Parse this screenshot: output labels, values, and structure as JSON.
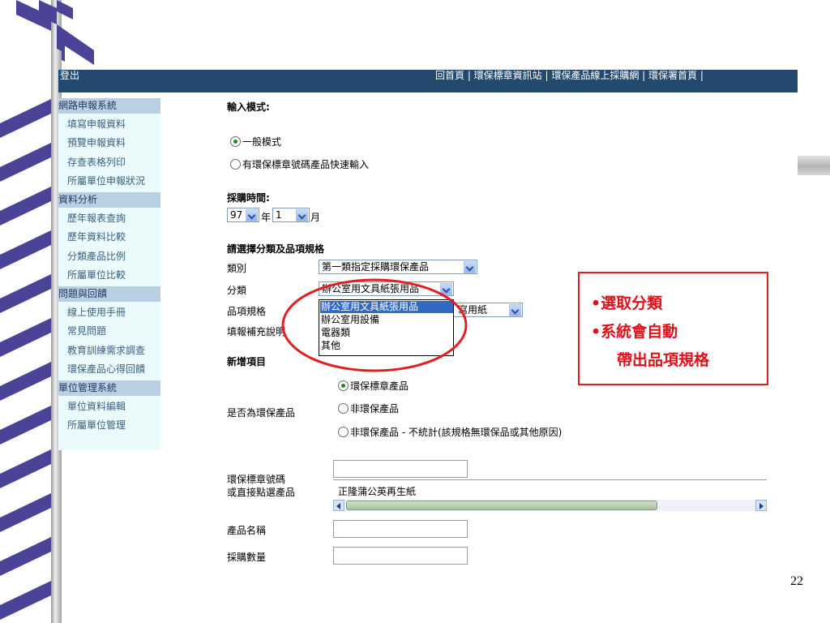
{
  "top_bar": {
    "left_label": "登出",
    "links": "回首頁 | 環保標章資訊站 | 環保產品線上採購網 | 環保署首頁 |"
  },
  "sidebar": {
    "items": [
      {
        "label": "網路申報系統",
        "type": "head"
      },
      {
        "label": "填寫申報資料",
        "type": "sub"
      },
      {
        "label": "預覽申報資料",
        "type": "sub"
      },
      {
        "label": "存查表格列印",
        "type": "sub"
      },
      {
        "label": "所屬單位申報狀況",
        "type": "sub"
      },
      {
        "label": "資料分析",
        "type": "head"
      },
      {
        "label": "歷年報表查詢",
        "type": "sub"
      },
      {
        "label": "歷年資料比較",
        "type": "sub"
      },
      {
        "label": "分類產品比例",
        "type": "sub"
      },
      {
        "label": "所屬單位比較",
        "type": "sub"
      },
      {
        "label": "問題與回饋",
        "type": "head"
      },
      {
        "label": "線上使用手冊",
        "type": "sub"
      },
      {
        "label": "常見問題",
        "type": "sub"
      },
      {
        "label": "教育訓練需求調查",
        "type": "sub"
      },
      {
        "label": "環保產品心得回饋",
        "type": "sub"
      },
      {
        "label": "單位管理系統",
        "type": "head"
      },
      {
        "label": "單位資料編輯",
        "type": "sub"
      },
      {
        "label": "所屬單位管理",
        "type": "sub"
      }
    ]
  },
  "form": {
    "input_mode_title": "輸入模式:",
    "mode_options": [
      "一般模式",
      "有環保標章號碼產品快速輸入"
    ],
    "mode_selected": 0,
    "purchase_time_title": "採購時間:",
    "year_value": "97",
    "year_unit": "年",
    "month_value": "1",
    "month_unit": "月",
    "category_section_title": "請選擇分類及品項規格",
    "category_label": "類別",
    "category_value": "第一類指定採購環保產品",
    "class_label": "分類",
    "class_value": "辦公室用文具紙張用品",
    "spec_label": "品項規格",
    "spec_value_fragment": "寫用紙",
    "note_label": "填報補充說明",
    "class_options": [
      "辦公室用文具紙張用品",
      "辦公室用設備",
      "電器類",
      "其他"
    ],
    "class_options_highlighted": 0,
    "new_item_title": "新增項目",
    "eco_question_label": "是否為環保產品",
    "eco_options": [
      "環保標章產品",
      "非環保產品",
      "非環保產品 - 不統計(該規格無環保品或其他原因)"
    ],
    "eco_selected": 0,
    "mark_number_label_1": "環保標章號碼",
    "mark_number_label_2": "或直接點選產品",
    "product_picker_value": "正隆蒲公英再生紙",
    "product_name_label": "產品名稱",
    "quantity_label": "採購數量"
  },
  "callout": {
    "lines": [
      "•選取分類",
      "•系統會自動",
      "帶出品項規格"
    ],
    "color": "#e02020"
  },
  "page_number": "22",
  "colors": {
    "top_bar": "#234a6e",
    "sidebar_bg": "#ebfbfb",
    "sidebar_head": "#b9cfe2",
    "highlight": "#316ac5",
    "annotation_red": "#e02020"
  }
}
